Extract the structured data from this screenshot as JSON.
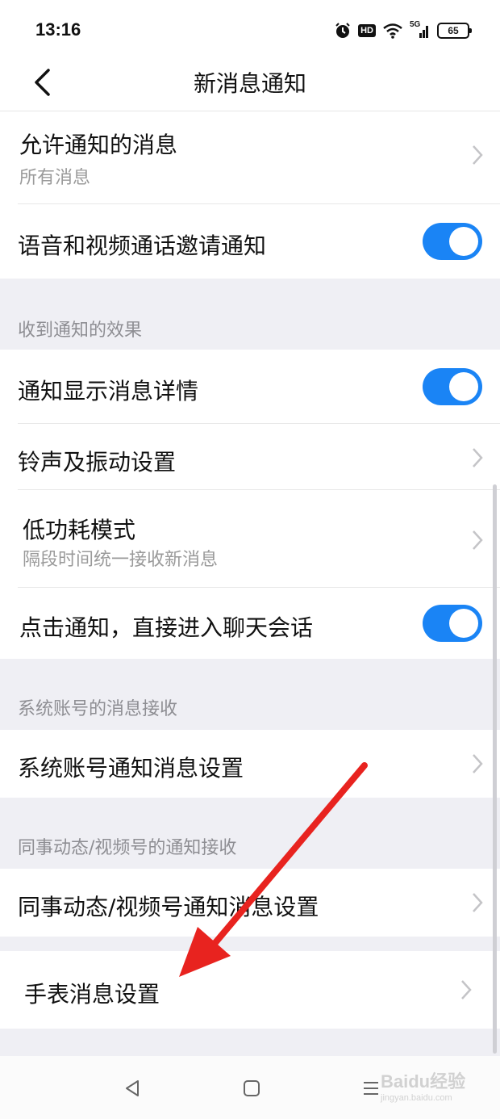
{
  "status_bar": {
    "time": "13:16",
    "hd": "HD",
    "network": "5G",
    "battery": "65",
    "icons": [
      "alarm-icon",
      "hd-icon",
      "wifi-icon",
      "signal-icon",
      "battery-icon"
    ]
  },
  "header": {
    "title": "新消息通知",
    "back_icon": "chevron-left-icon"
  },
  "settings": {
    "allowed_messages": {
      "label": "允许通知的消息",
      "value": "所有消息"
    },
    "call_invite": {
      "label": "语音和视频通话邀请通知",
      "enabled": true
    },
    "section_effect": "收到通知的效果",
    "show_details": {
      "label": "通知显示消息详情",
      "enabled": true
    },
    "ringtone": {
      "label": "铃声及振动设置"
    },
    "low_power": {
      "label": "低功耗模式",
      "description": "隔段时间统一接收新消息"
    },
    "tap_to_chat": {
      "label": "点击通知，直接进入聊天会话",
      "enabled": true
    },
    "section_system": "系统账号的消息接收",
    "system_account": {
      "label": "系统账号通知消息设置"
    },
    "section_moments": "同事动态/视频号的通知接收",
    "moments": {
      "label": "同事动态/视频号通知消息设置"
    },
    "watch": {
      "label": "手表消息设置"
    }
  },
  "bottom_nav": {
    "icons": [
      "back-triangle-icon",
      "home-square-icon",
      "menu-lines-icon"
    ]
  },
  "watermark": {
    "main": "Baidu经验",
    "sub": "jingyan.baidu.com"
  },
  "colors": {
    "toggle_on": "#1a84f5",
    "section_bg": "#efeff4",
    "annotation_arrow": "#e8231f"
  }
}
